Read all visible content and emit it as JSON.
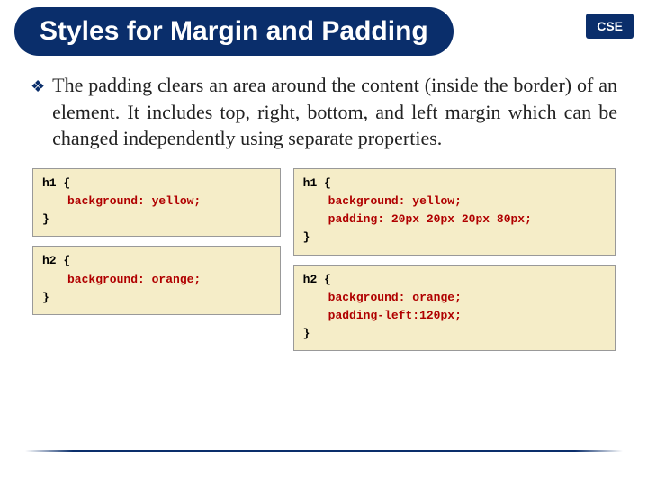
{
  "header": {
    "title": "Styles for Margin and Padding",
    "badge": "CSE"
  },
  "body": {
    "bullet_glyph": "❖",
    "paragraph": "The padding clears an area around the content (inside the border) of an element. It includes top, right, bottom, and left margin which can be changed independently using separate properties."
  },
  "code": {
    "left_block1": {
      "sel_open": "h1 {",
      "prop1": "background: yellow;",
      "sel_close": "}"
    },
    "left_block2": {
      "sel_open": "h2 {",
      "prop1": "background: orange;",
      "sel_close": "}"
    },
    "right_block1": {
      "sel_open": "h1 {",
      "prop1": "background: yellow;",
      "prop2": "padding: 20px 20px 20px 80px;",
      "sel_close": "}"
    },
    "right_block2": {
      "sel_open": "h2 {",
      "prop1": "background: orange;",
      "prop2": "padding-left:120px;",
      "sel_close": "}"
    }
  }
}
